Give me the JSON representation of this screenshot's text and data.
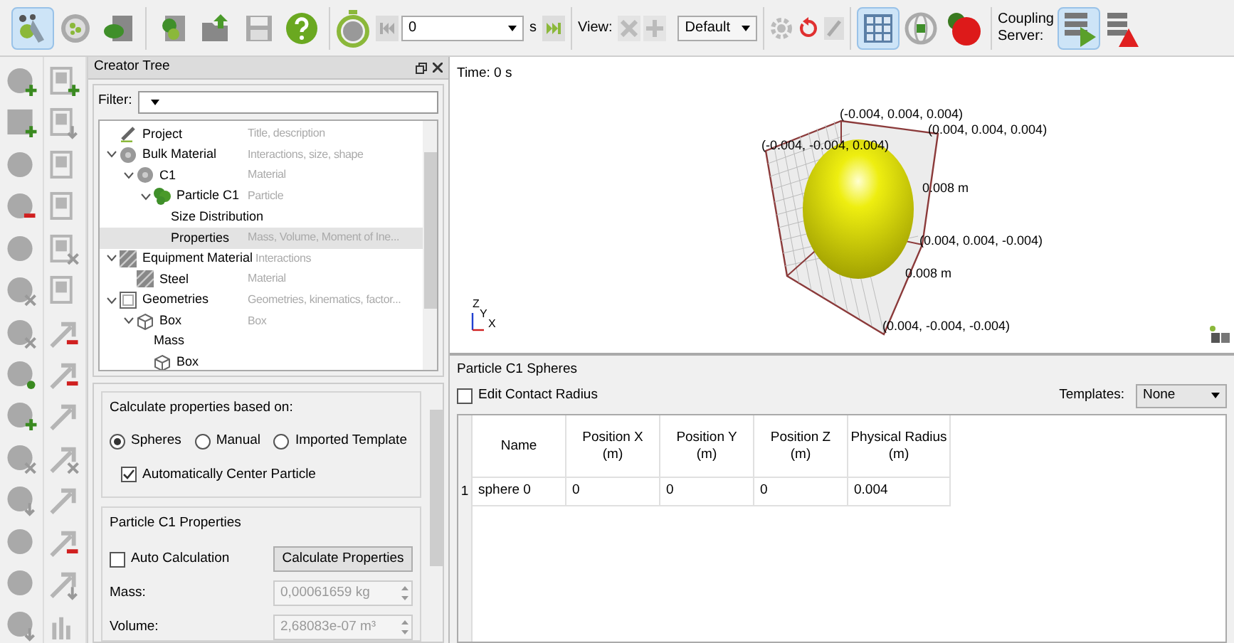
{
  "toolbar": {
    "mode_buttons": [
      {
        "selected": true
      },
      {
        "selected": false
      },
      {
        "selected": false
      }
    ],
    "time": {
      "value": "0",
      "unit": "s"
    },
    "view_label": "View:",
    "view_select": "Default",
    "grid_selected": true,
    "coupling_label": "Coupling Server:",
    "coupling_start_selected": true
  },
  "creator_tree": {
    "title": "Creator Tree",
    "filter_label": "Filter:",
    "items": [
      {
        "kind": "pencil",
        "label": "Project",
        "desc": "Title, description",
        "selected": false
      },
      {
        "kind": "material",
        "label": "Bulk Material",
        "desc": "Interactions, size, shape",
        "selected": false,
        "expanded": true,
        "children": [
          {
            "kind": "material",
            "label": "C1",
            "desc": "Material",
            "selected": false,
            "expanded": true,
            "children": [
              {
                "kind": "particle",
                "label": "Particle C1",
                "desc": "Particle",
                "selected": false,
                "expanded": true,
                "children": [
                  {
                    "kind": "plain",
                    "label": "Size Distribution",
                    "selected": false
                  },
                  {
                    "kind": "plain",
                    "label": "Properties",
                    "desc": "Mass, Volume, Moment of Ine...",
                    "selected": true
                  }
                ]
              }
            ]
          }
        ]
      },
      {
        "kind": "hatched",
        "label": "Equipment Material",
        "desc": "Interactions",
        "selected": false,
        "expanded": true,
        "children": [
          {
            "kind": "hatched",
            "label": "Steel",
            "desc": "Material",
            "selected": false
          }
        ]
      },
      {
        "kind": "frame",
        "label": "Geometries",
        "desc": "Geometries, kinematics, factor...",
        "selected": false,
        "expanded": true,
        "children": [
          {
            "kind": "box",
            "label": "Box",
            "desc": "Box",
            "selected": false,
            "expanded": true,
            "children": [
              {
                "kind": "plain",
                "label": "Mass",
                "selected": false
              },
              {
                "kind": "box",
                "label": "Box",
                "selected": false
              }
            ]
          }
        ]
      }
    ]
  },
  "properties": {
    "basis_title": "Calculate properties based on:",
    "basis_options": [
      {
        "label": "Spheres",
        "selected": true
      },
      {
        "label": "Manual",
        "selected": false
      },
      {
        "label": "Imported Template",
        "selected": false
      }
    ],
    "auto_center": {
      "label": "Automatically Center Particle",
      "checked": true
    },
    "particle_title": "Particle C1 Properties",
    "auto_calc": {
      "label": "Auto Calculation",
      "checked": false
    },
    "calc_button": "Calculate Properties",
    "fields": [
      {
        "label": "Mass:",
        "value": "0,00061659 kg",
        "disabled": true
      },
      {
        "label": "Volume:",
        "value": "2,68083e-07 m³",
        "disabled": true
      }
    ]
  },
  "viewport": {
    "time": "Time: 0 s",
    "labels": [
      "(-0.004, 0.004, 0.004)",
      "(0.004, 0.004, 0.004)",
      "(-0.004, -0.004, 0.004)",
      "0.008 m",
      "(0.004, 0.004, -0.004)",
      "0.008 m",
      "(0.004, -0.004, -0.004)"
    ],
    "axes": [
      "Z",
      "Y",
      "X"
    ]
  },
  "spheres": {
    "title": "Particle C1 Spheres",
    "edit_contact": {
      "label": "Edit Contact Radius",
      "checked": false
    },
    "templates_label": "Templates:",
    "templates_value": "None",
    "columns": [
      {
        "label": "Name"
      },
      {
        "label": "Position X",
        "unit": "(m)"
      },
      {
        "label": "Position Y",
        "unit": "(m)"
      },
      {
        "label": "Position Z",
        "unit": "(m)"
      },
      {
        "label": "Physical Radius",
        "unit": "(m)"
      }
    ],
    "rows": [
      {
        "number": "1",
        "cells": [
          "sphere 0",
          "0",
          "0",
          "0",
          "0.004"
        ]
      }
    ]
  }
}
